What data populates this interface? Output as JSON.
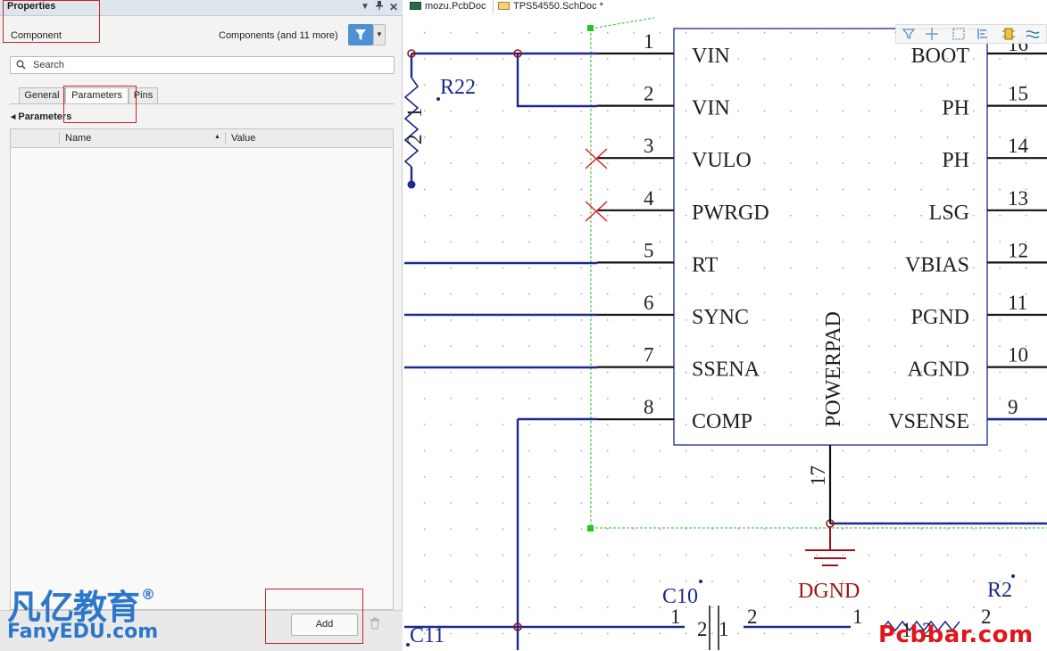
{
  "panel": {
    "title": "Properties",
    "component_label": "Component",
    "component_filter": "Components (and 11 more)",
    "search_placeholder": "Search",
    "tabs": [
      {
        "label": "General"
      },
      {
        "label": "Parameters"
      },
      {
        "label": "Pins"
      }
    ],
    "section_title": "Parameters",
    "columns": {
      "name": "Name",
      "value": "Value"
    },
    "add_label": "Add"
  },
  "watermark": {
    "cn": "凡亿教育",
    "reg": "®",
    "en": "FanyEDU.com",
    "site": "Pcbbar.com"
  },
  "documents": [
    {
      "label": "mozu.PcbDoc"
    },
    {
      "label": "TPS54550.SchDoc *"
    }
  ],
  "schematic": {
    "left_pins": [
      {
        "num": "1",
        "name": "VIN"
      },
      {
        "num": "2",
        "name": "VIN"
      },
      {
        "num": "3",
        "name": "VULO"
      },
      {
        "num": "4",
        "name": "PWRGD"
      },
      {
        "num": "5",
        "name": "RT"
      },
      {
        "num": "6",
        "name": "SYNC"
      },
      {
        "num": "7",
        "name": "SSENA"
      },
      {
        "num": "8",
        "name": "COMP"
      }
    ],
    "right_pins": [
      {
        "num": "16",
        "name": "BOOT"
      },
      {
        "num": "15",
        "name": "PH"
      },
      {
        "num": "14",
        "name": "PH"
      },
      {
        "num": "13",
        "name": "LSG"
      },
      {
        "num": "12",
        "name": "VBIAS"
      },
      {
        "num": "11",
        "name": "PGND"
      },
      {
        "num": "10",
        "name": "AGND"
      },
      {
        "num": "9",
        "name": "VSENSE"
      }
    ],
    "powerpad": {
      "name": "POWERPAD",
      "num": "17"
    },
    "r22": {
      "designator": "R22",
      "pin1": "1",
      "pin2": "2"
    },
    "ground_label": "DGND",
    "c10": {
      "designator": "C10",
      "pin1": "1",
      "pin2": "2"
    },
    "c11": {
      "designator": "C11"
    },
    "r2": {
      "designator": "R2",
      "pin1": "1",
      "pin2": "2"
    },
    "wire_labels": {
      "c10_p2b": "2",
      "c10_p1b": "1",
      "mid_p1": "1"
    },
    "colors": {
      "wire": "#1b2a8c",
      "pin": "#111111",
      "ground": "#9b1414",
      "junction": "#9b1414",
      "noconnect": "#d4232a",
      "highlight": "#c0282a",
      "filter_button": "#4f90d2"
    }
  }
}
